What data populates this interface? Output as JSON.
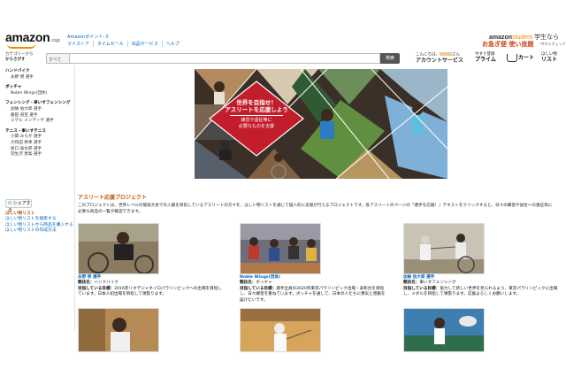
{
  "header": {
    "logo_text": "amazon",
    "logo_sub": ".co.jp",
    "points_label": "Amazonポイント: 0",
    "toplinks": [
      "マイストア",
      "タイムセール",
      "出品サービス",
      "ヘルプ"
    ],
    "student_brand": "amazon",
    "student_brand2": "student",
    "student_label": "学生なら",
    "student_tagline": "お急ぎ便 使い放題",
    "student_sub": "›今すぐチェック"
  },
  "searchbar": {
    "shop_by_1": "カテゴリーから",
    "shop_by_2": "からさがす",
    "category": "すべて",
    "button_label": "検索",
    "account_line1": "こんにちは、",
    "account_line1_end": "さん",
    "account_line2": "アカウントサービス",
    "prime_line1": "今すぐ登録",
    "prime_line2": "プライム",
    "cart_label": "カート",
    "wish_line1": "ほしい物",
    "wish_line2": "リスト"
  },
  "sidebar": {
    "groups": [
      {
        "category": "ハンドバイク",
        "items": [
          "永野 明 選手"
        ]
      },
      {
        "category": "ボッチャ",
        "items": [
          "Noble Wings(団体)"
        ]
      },
      {
        "category": "フェンシング・車いすフェンシング",
        "items": [
          "加納 佑大郎 選手",
          "藤田 道宣 選手",
          "ミゲル メンデーザ 選手"
        ]
      },
      {
        "category": "テニス・車いすテニス",
        "items": [
          "小関 みらか 選手",
          "大和田 秀幸 選手",
          "坂口 竜太郎 選手",
          "羽生沢 恵梨 選手"
        ]
      }
    ],
    "share_label": "シェアする",
    "wishlist_title": "ほしい物リスト",
    "wishlist_links": [
      "ほしい物リストを検索する",
      "ほしい物リストから商品を購入する",
      "ほしい物リストの作成方法"
    ]
  },
  "banner": {
    "headline_1": "世界を目指せ！",
    "headline_2": "アスリートを応援しよう",
    "sub_1": "練習や遠征等に",
    "sub_2": "必要なものを支援"
  },
  "project": {
    "title": "アスリート応援プロジェクト",
    "description": "このプロジェクトは、世界レベルの競技大会での入賞を目指しているアスリートの方々を、ほしい物リストを通じて個人的に支援が行えるプロジェクトです。各アスリートのページの「選手を応援！」テキストをクリックすると、日々の練習や試合への遠征等に必要な商品の一覧が確認できます。"
  },
  "athletes": [
    {
      "name": "永野 明 選手",
      "event_label": "競技名：",
      "event": "ハンドバイク",
      "goal_label": "目指している目標：",
      "goal": "2016年リオデジャネイロパラリンピックへの出場を目指しています。日本人初出場を目指して頑張ります。"
    },
    {
      "name": "Noble Wings(団体)",
      "event_label": "競技名：",
      "event": "ボッチャ",
      "goal_label": "目指している目標：",
      "goal": "選手全員の2020年東京パラリンピック出場・表彰台を目指し、日々練習を重ねています。ボッチャを通して、日本の人たちに勇気と感動を届けたいです。"
    },
    {
      "name": "加納 佑大郎 選手",
      "event_label": "競技名：",
      "event": "車いすフェンシング",
      "goal_label": "目指している目標：",
      "goal": "協力して新しい世界を見られるよう、東京パラリンピックに出場し、メダルを目指して頑張ります。応援よろしくお願いします。"
    }
  ],
  "colors": {
    "accent": "#f08c00",
    "link": "#0066c0",
    "heading": "#c45500"
  }
}
